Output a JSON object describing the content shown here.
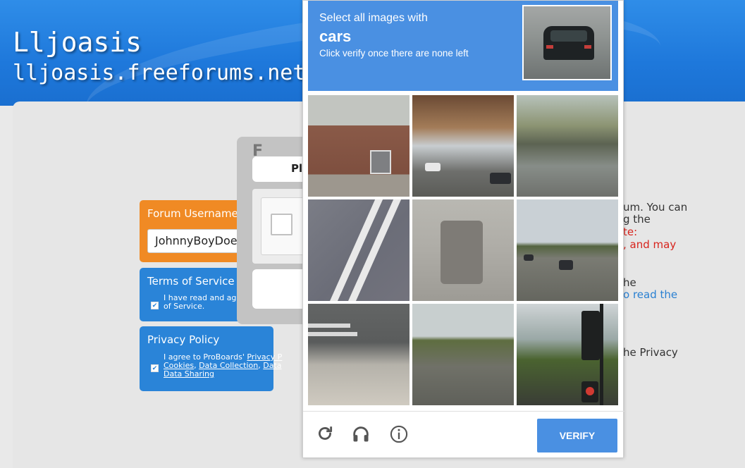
{
  "site": {
    "title": "Lljoasis",
    "url": "lljoasis.freeforums.net"
  },
  "form": {
    "username_label": "Forum Username",
    "username_value": "JohnnyBoyDoe",
    "terms_heading": "Terms of Service A",
    "terms_line1": "I have read and agr",
    "terms_line2": "of Service.",
    "privacy_heading": "Privacy Policy",
    "privacy_line1_text": "I agree to ProBoards' ",
    "privacy_line1_link": "Privacy P",
    "privacy_line2_a": "Cookies",
    "privacy_line2_sep1": ", ",
    "privacy_line2_b": "Data Collection",
    "privacy_line2_sep2": ", ",
    "privacy_line2_c": "Data",
    "privacy_line3": "Data Sharing"
  },
  "side": {
    "line1": "um. You can",
    "line2": "g the",
    "line3": "te:",
    "line4": ", and may",
    "line5": "he",
    "line6": "o read the",
    "line7": "he Privacy"
  },
  "dialog": {
    "title_fragment": "F",
    "pill_fragment": "Pl"
  },
  "captcha": {
    "instruction": "Select all images with",
    "target": "cars",
    "subinstruction": "Click verify once there are none left",
    "verify_label": "VERIFY",
    "icons": {
      "reload": "reload-icon",
      "audio": "headphones-icon",
      "info": "info-icon"
    },
    "accent_color": "#4a90e2"
  },
  "colors": {
    "header_blue": "#1e78db",
    "username_orange": "#f08a24",
    "form_blue": "#2a84d8",
    "warning_red": "#d8241d"
  }
}
